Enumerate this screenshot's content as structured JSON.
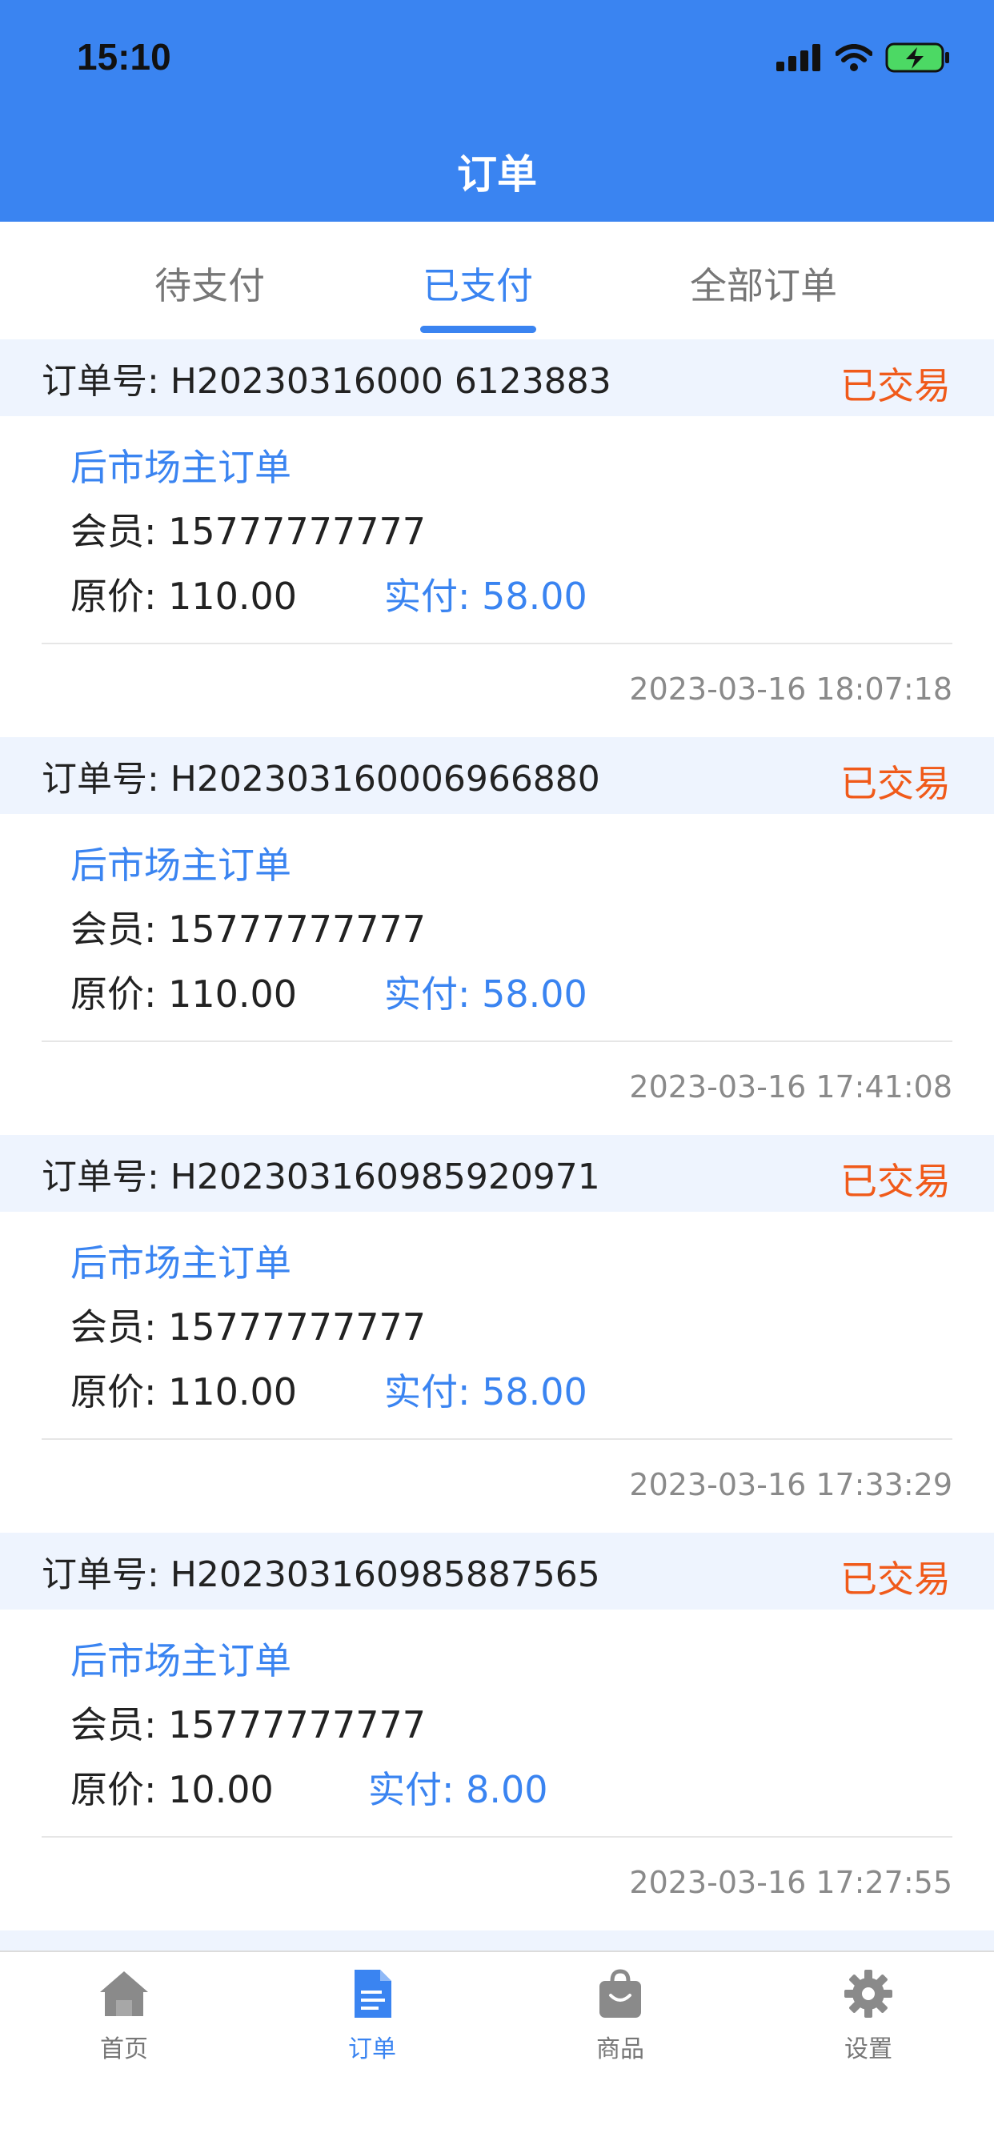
{
  "status": {
    "time": "15:10"
  },
  "header": {
    "title": "订单"
  },
  "tabs": [
    {
      "label": "待支付"
    },
    {
      "label": "已支付"
    },
    {
      "label": "全部订单"
    }
  ],
  "active_tab": "已支付",
  "orders": [
    {
      "order_no": "订单号: H20230316000 6123883",
      "state": "已交易",
      "type": "后市场主订单",
      "member": "会员: 15777777777",
      "price": "原价: 110.00",
      "paid": "实付: 58.00",
      "time": "2023-03-16 18:07:18"
    },
    {
      "order_no": "订单号: H202303160006966880",
      "state": "已交易",
      "type": "后市场主订单",
      "member": "会员: 15777777777",
      "price": "原价: 110.00",
      "paid": "实付: 58.00",
      "time": "2023-03-16 17:41:08"
    },
    {
      "order_no": "订单号: H202303160985920971",
      "state": "已交易",
      "type": "后市场主订单",
      "member": "会员: 15777777777",
      "price": "原价: 110.00",
      "paid": "实付: 58.00",
      "time": "2023-03-16 17:33:29"
    },
    {
      "order_no": "订单号: H202303160985887565",
      "state": "已交易",
      "type": "后市场主订单",
      "member": "会员: 15777777777",
      "price": "原价: 10.00",
      "paid": "实付: 8.00",
      "time": "2023-03-16 17:27:55"
    }
  ],
  "tabbar": [
    {
      "label": "首页",
      "icon": "home-icon"
    },
    {
      "label": "订单",
      "icon": "document-icon"
    },
    {
      "label": "商品",
      "icon": "shopping-bag-icon"
    },
    {
      "label": "设置",
      "icon": "gear-icon"
    }
  ],
  "colors": {
    "primary": "#3a84f1",
    "status_done": "#f05a1a",
    "order_header_bg": "#eef4fe"
  }
}
